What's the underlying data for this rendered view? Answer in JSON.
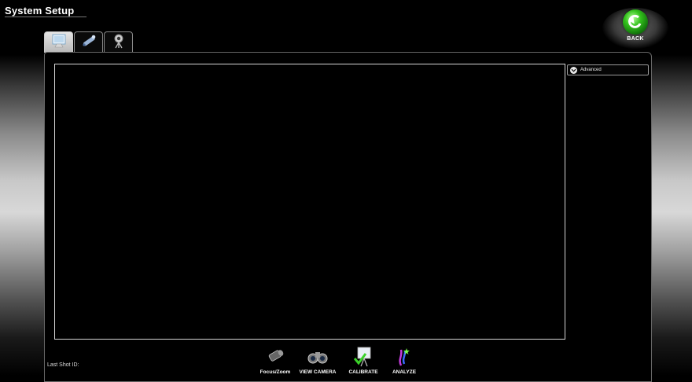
{
  "window": {
    "title": "System Setup"
  },
  "back_button": {
    "label": "BACK"
  },
  "tabs": [
    {
      "icon": "monitor-icon",
      "active": true
    },
    {
      "icon": "projector-icon",
      "active": false
    },
    {
      "icon": "camera-icon",
      "active": false
    }
  ],
  "advanced": {
    "label": "Advanced",
    "icon": "chevron-down-icon"
  },
  "status": {
    "last_shot_label": "Last Shot ID:"
  },
  "toolbar": {
    "focus_zoom": "Focus/Zoom",
    "view_camera": "VIEW CAMERA",
    "calibrate": "CALIBRATE",
    "analyze": "ANALYZE"
  },
  "colors": {
    "back_green": "#33c21c",
    "panel_border": "#666666",
    "viewport_border": "#d6d6d6"
  }
}
